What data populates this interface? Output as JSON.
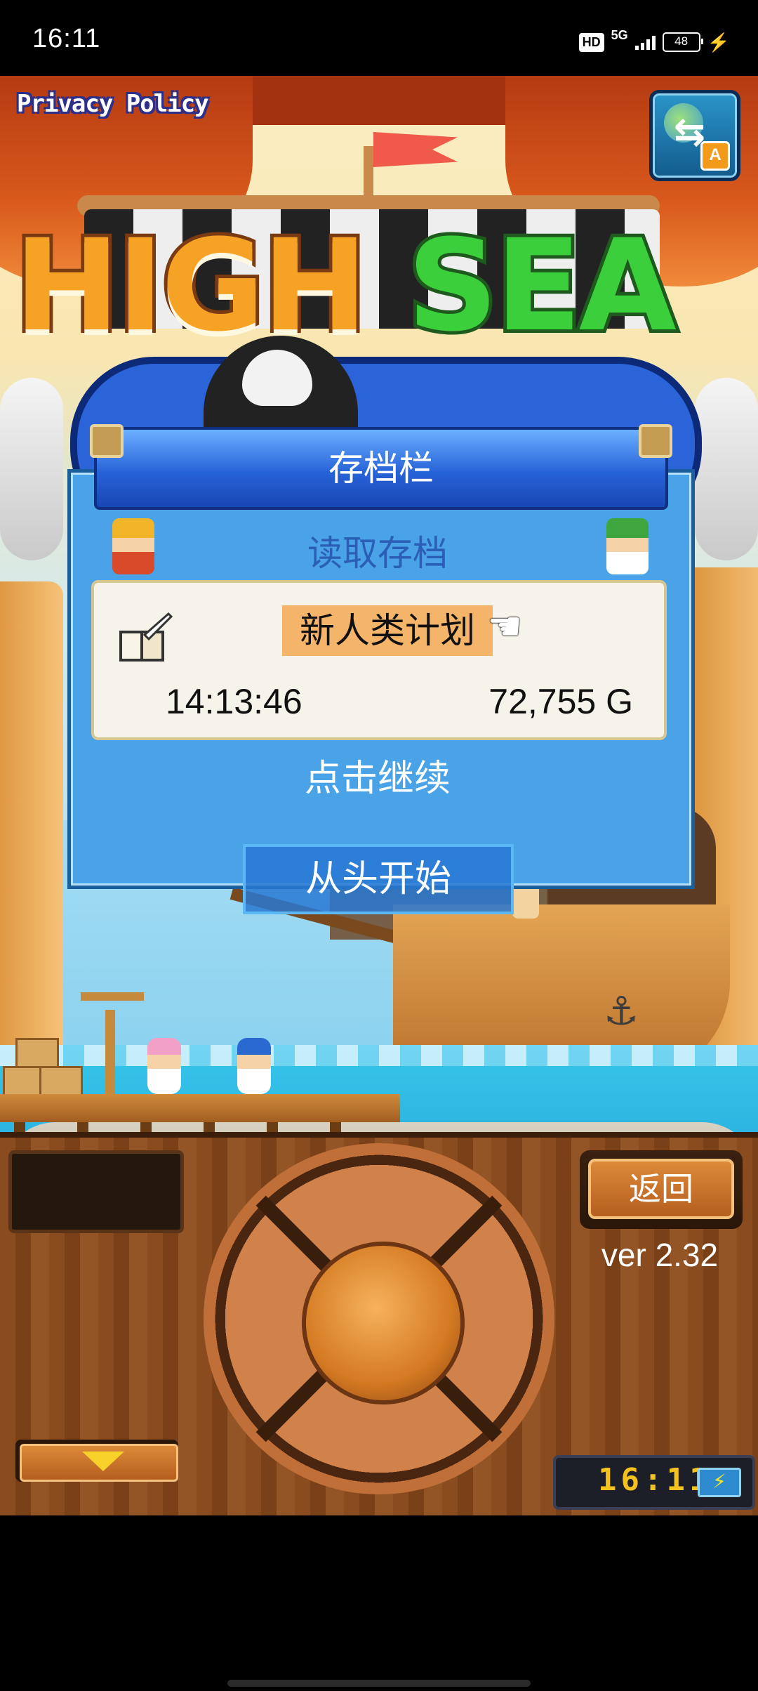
{
  "status_bar": {
    "time": "16:11",
    "hd": "HD",
    "network": "5G",
    "battery": "48"
  },
  "header": {
    "privacy_link": "Privacy Policy",
    "language_badge": "A"
  },
  "logo": {
    "word1": "HIGH",
    "word2": "SEA"
  },
  "dialog": {
    "title": "存档栏",
    "subtitle": "读取存档",
    "slot": {
      "name": "新人类计划",
      "play_time": "14:13:46",
      "gold": "72,755 G"
    },
    "continue_label": "点击继续"
  },
  "restart_label": "从头开始",
  "panel": {
    "back_label": "返回",
    "version": "ver 2.32",
    "clock": "16:11"
  },
  "colors": {
    "dialog_blue": "#4aa3e6",
    "title_blue": "#2763d8",
    "wood": "#8a4c1f",
    "slot_highlight": "#f4b46a"
  },
  "icons": [
    "globe-language-icon",
    "book-quill-icon",
    "pointing-hand-icon",
    "down-arrow-icon",
    "battery-charging-icon"
  ]
}
